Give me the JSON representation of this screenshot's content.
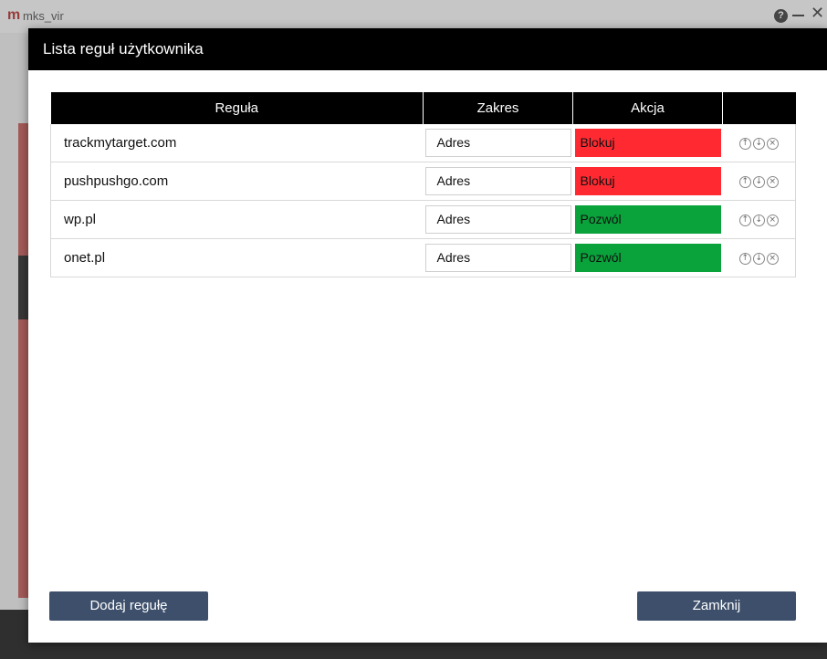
{
  "background_app": {
    "logo": "m",
    "title": "mks_vir",
    "help": "?"
  },
  "dialog": {
    "title": "Lista reguł użytkownika",
    "columns": [
      "Reguła",
      "Zakres",
      "Akcja",
      ""
    ],
    "rows": [
      {
        "rule": "trackmytarget.com",
        "scope": "Adres",
        "action": "Blokuj",
        "action_color": "#ff2a31"
      },
      {
        "rule": "pushpushgo.com",
        "scope": "Adres",
        "action": "Blokuj",
        "action_color": "#ff2a31"
      },
      {
        "rule": "wp.pl",
        "scope": "Adres",
        "action": "Pozwól",
        "action_color": "#09a23b"
      },
      {
        "rule": "onet.pl",
        "scope": "Adres",
        "action": "Pozwól",
        "action_color": "#09a23b"
      }
    ],
    "row_icons": [
      "move-up-icon",
      "move-down-icon",
      "delete-icon"
    ],
    "add_button": "Dodaj regułę",
    "close_button": "Zamknij"
  }
}
